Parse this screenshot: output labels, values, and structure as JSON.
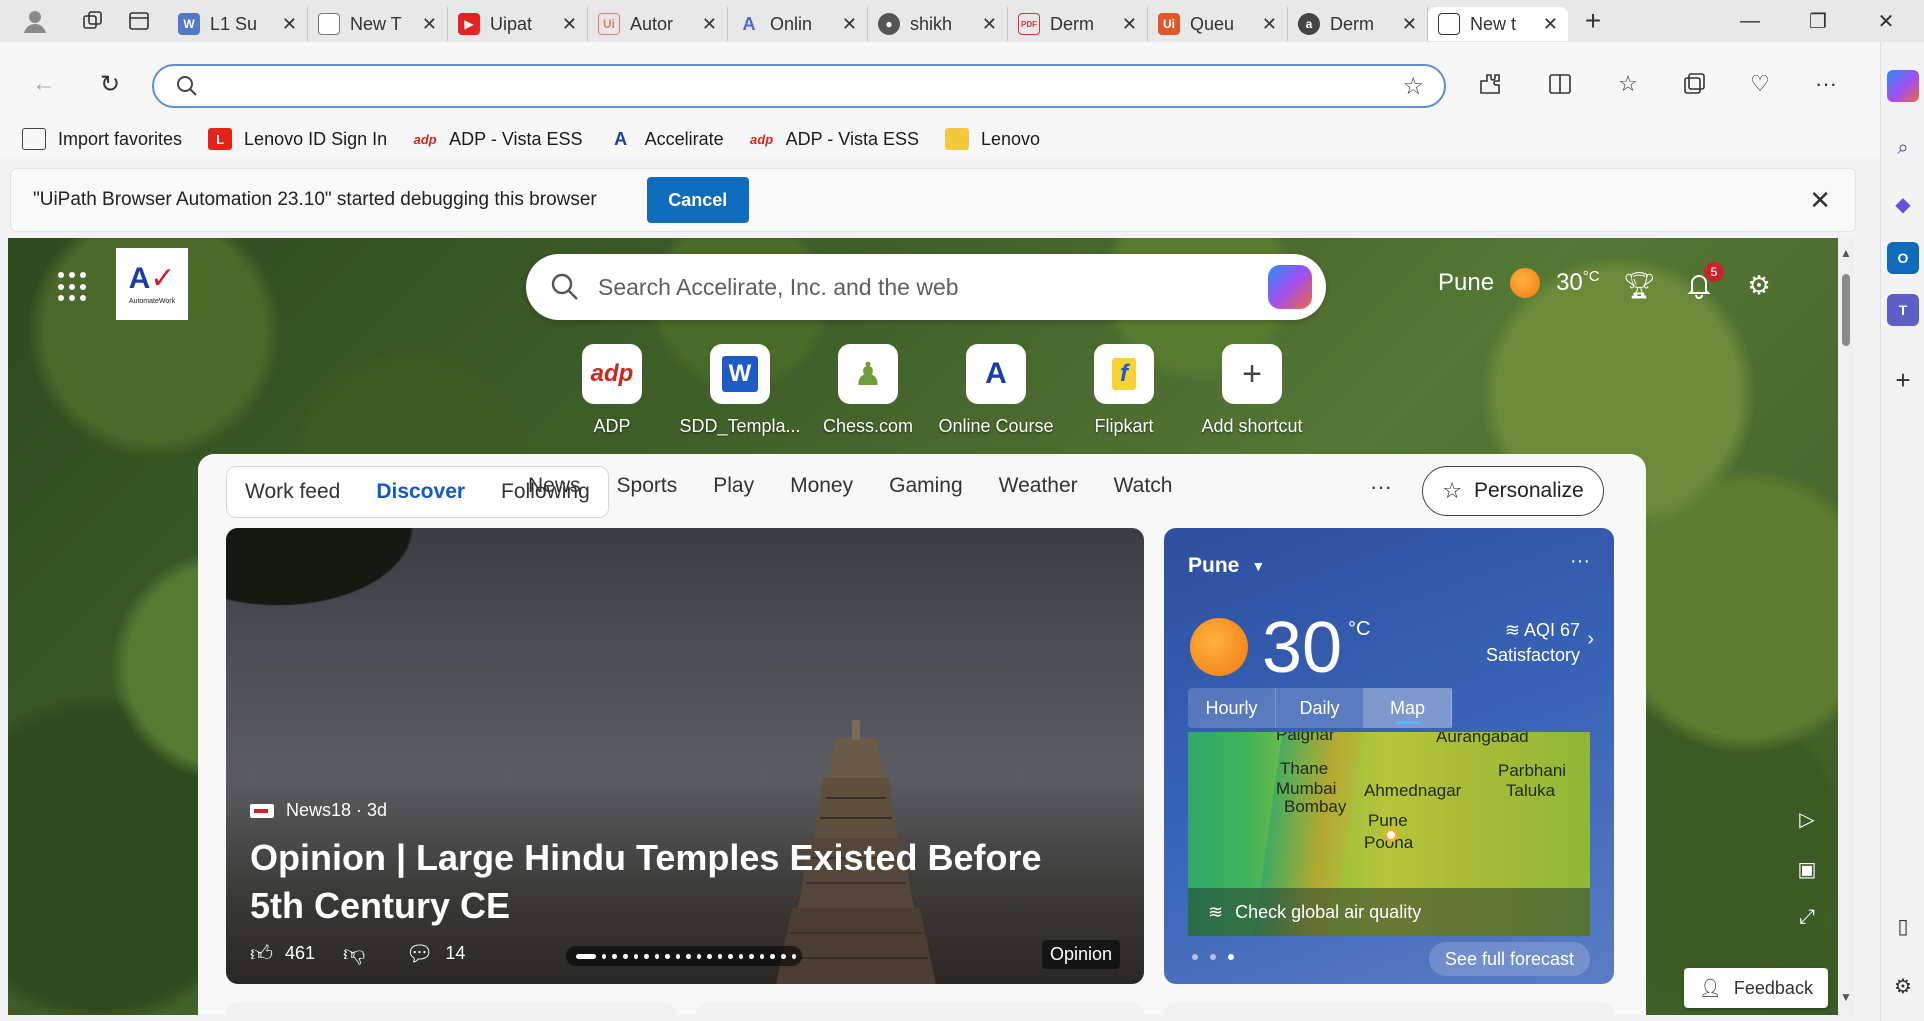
{
  "tabs": [
    {
      "label": "L1 Su",
      "icon": "word-doc-icon",
      "color": "#5577c8"
    },
    {
      "label": "New T",
      "icon": "page-icon",
      "color": "#9a9a9a"
    },
    {
      "label": "Uipat",
      "icon": "youtube-icon",
      "color": "#e32222"
    },
    {
      "label": "Autor",
      "icon": "uipath-icon",
      "color": "#f07a6a"
    },
    {
      "label": "Onlin",
      "icon": "accelirate-icon",
      "color": "#4a6ad0"
    },
    {
      "label": "shikh",
      "icon": "github-icon",
      "color": "#555555"
    },
    {
      "label": "Derm",
      "icon": "pdf-icon",
      "color": "#d23a3a"
    },
    {
      "label": "Queu",
      "icon": "uipath-icon",
      "color": "#e2572a"
    },
    {
      "label": "Derm",
      "icon": "site-icon",
      "color": "#444444"
    },
    {
      "label": "New t",
      "icon": "new-tab-page-icon",
      "color": "#333333",
      "active": true
    }
  ],
  "toolbar": {
    "address_value": ""
  },
  "favorites": [
    {
      "label": "Import favorites",
      "icon": "import-favorites-icon"
    },
    {
      "label": "Lenovo ID Sign In",
      "icon": "lenovo-icon"
    },
    {
      "label": "ADP - Vista ESS",
      "icon": "adp-icon"
    },
    {
      "label": "Accelirate",
      "icon": "accelirate-icon"
    },
    {
      "label": "ADP - Vista ESS",
      "icon": "adp-icon"
    },
    {
      "label": "Lenovo",
      "icon": "folder-icon"
    }
  ],
  "infobar": {
    "message": "\"UiPath Browser Automation 23.10\" started debugging this browser",
    "cancel_label": "Cancel"
  },
  "page": {
    "org_logo_text": "AutomateWork",
    "search_placeholder": "Search Accelirate, Inc. and the web",
    "weather_city": "Pune",
    "weather_temp": "30",
    "weather_unit": "°C",
    "notification_count": "5"
  },
  "shortcuts": [
    {
      "label": "ADP",
      "icon": "adp-icon"
    },
    {
      "label": "SDD_Templa...",
      "icon": "word-icon"
    },
    {
      "label": "Chess.com",
      "icon": "chess-icon"
    },
    {
      "label": "Online Course",
      "icon": "accelirate-icon"
    },
    {
      "label": "Flipkart",
      "icon": "flipkart-icon"
    },
    {
      "label": "Add shortcut",
      "icon": "plus-icon"
    }
  ],
  "feed": {
    "pill_tabs": [
      "Work feed",
      "Discover",
      "Following"
    ],
    "selected_pill": "Discover",
    "categories": [
      "News",
      "Sports",
      "Play",
      "Money",
      "Gaming",
      "Weather",
      "Watch"
    ],
    "more": "···",
    "personalize_label": "Personalize"
  },
  "hero": {
    "source": "News18 · 3d",
    "title": "Opinion | Large Hindu Temples Existed Before 5th Century CE",
    "likes": "461",
    "comments": "14",
    "tag": "Opinion"
  },
  "weather_card": {
    "city": "Pune",
    "temp": "30",
    "unit": "°C",
    "aqi": "AQI 67",
    "aqi_status": "Satisfactory",
    "tabs": [
      "Hourly",
      "Daily",
      "Map"
    ],
    "selected_tab": "Map",
    "map_labels": [
      "Palghar",
      "Aurangabad",
      "Thane",
      "Mumbai",
      "Bombay",
      "Ahmednagar",
      "Parbhani",
      "Taluka",
      "Pune",
      "Poona"
    ],
    "air_quality_label": "Check global air quality",
    "forecast_label": "See full forecast"
  },
  "feedback_label": "Feedback",
  "colors": {
    "accent": "#0f6cbd",
    "feed_selected": "#1359c9",
    "weather_card": "#3963b8"
  }
}
